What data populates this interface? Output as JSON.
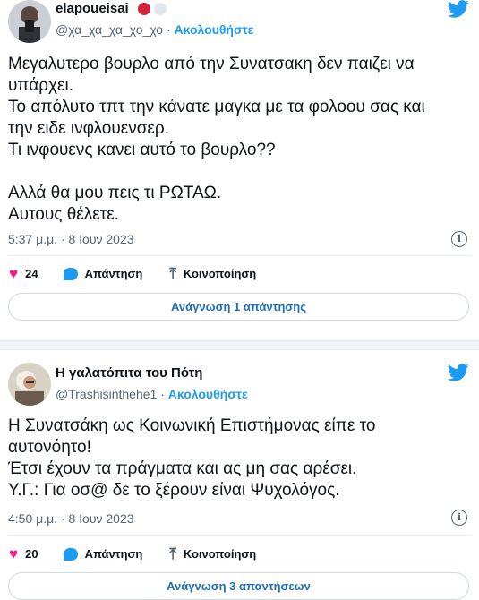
{
  "tweets": [
    {
      "name": "elapoueisai",
      "handle": "@χα_χα_χα_χο_χο",
      "sep": " · ",
      "follow": "Ακολουθήστε",
      "lines": [
        "Μεγαλυτερο βουρλο από την Συνατσακη δεν παιζει να",
        "υπάρχει.",
        "Το απόλυτο τπτ την κάνατε μαγκα με τα φολοου σας και",
        "την ειδε ινφλουενσερ.",
        "Τι ινφουενς κανει αυτό το βουρλο??",
        "",
        "Αλλά θα μου πεις τι ΡΩΤΑΩ.",
        "Αυτους θέλετε."
      ],
      "time": "5:37 μ.μ. · 8 Ιουν 2023",
      "likes": "24",
      "reply_label": "Απάντηση",
      "share_label": "Κοινοποίηση",
      "read_label": "Ανάγνωση 1 απάντησης",
      "colors": {
        "red_dot": "#d0243a",
        "gray_dot": "#e1e8ed"
      }
    },
    {
      "name": "Η γαλατόπιτα του Πότη",
      "handle": "@Trashisinthehe1",
      "sep": " · ",
      "follow": "Ακολουθήστε",
      "lines": [
        "Η Συνατσάκη ως Κοινωνική Επιστήμονας είπε το",
        "αυτονόητο!",
        "Έτσι έχουν τα πράγματα και ας μη σας αρέσει.",
        "Υ.Γ.: Για οσ@ δε το ξέρουν είναι Ψυχολόγος."
      ],
      "time": "4:50 μ.μ. · 8 Ιουν 2023",
      "likes": "20",
      "reply_label": "Απάντηση",
      "share_label": "Κοινοποίηση",
      "read_label": "Ανάγνωση 3 απαντήσεων"
    }
  ],
  "colors": {
    "accent": "#1d9bf0",
    "heart": "#f91880",
    "muted": "#536471"
  },
  "icons": [
    "twitter-bird-icon",
    "heart-icon",
    "reply-icon",
    "share-icon",
    "info-icon"
  ]
}
